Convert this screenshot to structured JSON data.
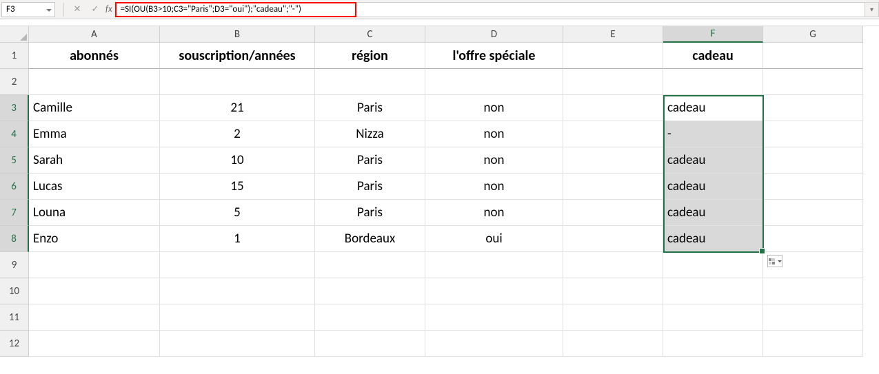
{
  "nameBox": "F3",
  "formula": "=SI(OU(B3>10;C3=\"Paris\";D3=\"oui\");\"cadeau\";\"-\")",
  "columns": [
    "A",
    "B",
    "C",
    "D",
    "E",
    "F",
    "G"
  ],
  "rowCount": 12,
  "selectedColIndex": 5,
  "selectedRowStart": 3,
  "selectedRowEnd": 8,
  "headers": {
    "A": "abonnés",
    "B": "souscription/années",
    "C": "région",
    "D": "l'offre spéciale",
    "F": "cadeau"
  },
  "rowsData": [
    {
      "A": "Camille",
      "B": "21",
      "C": "Paris",
      "D": "non",
      "F": "cadeau"
    },
    {
      "A": "Emma",
      "B": "2",
      "C": "Nizza",
      "D": "non",
      "F": "-"
    },
    {
      "A": "Sarah",
      "B": "10",
      "C": "Paris",
      "D": "non",
      "F": "cadeau"
    },
    {
      "A": "Lucas",
      "B": "15",
      "C": "Paris",
      "D": "non",
      "F": "cadeau"
    },
    {
      "A": "Louna",
      "B": "5",
      "C": "Paris",
      "D": "non",
      "F": "cadeau"
    },
    {
      "A": "Enzo",
      "B": "1",
      "C": "Bordeaux",
      "D": "oui",
      "F": "cadeau"
    }
  ],
  "icons": {
    "cancel": "✕",
    "check": "✓",
    "expand": "▾"
  }
}
